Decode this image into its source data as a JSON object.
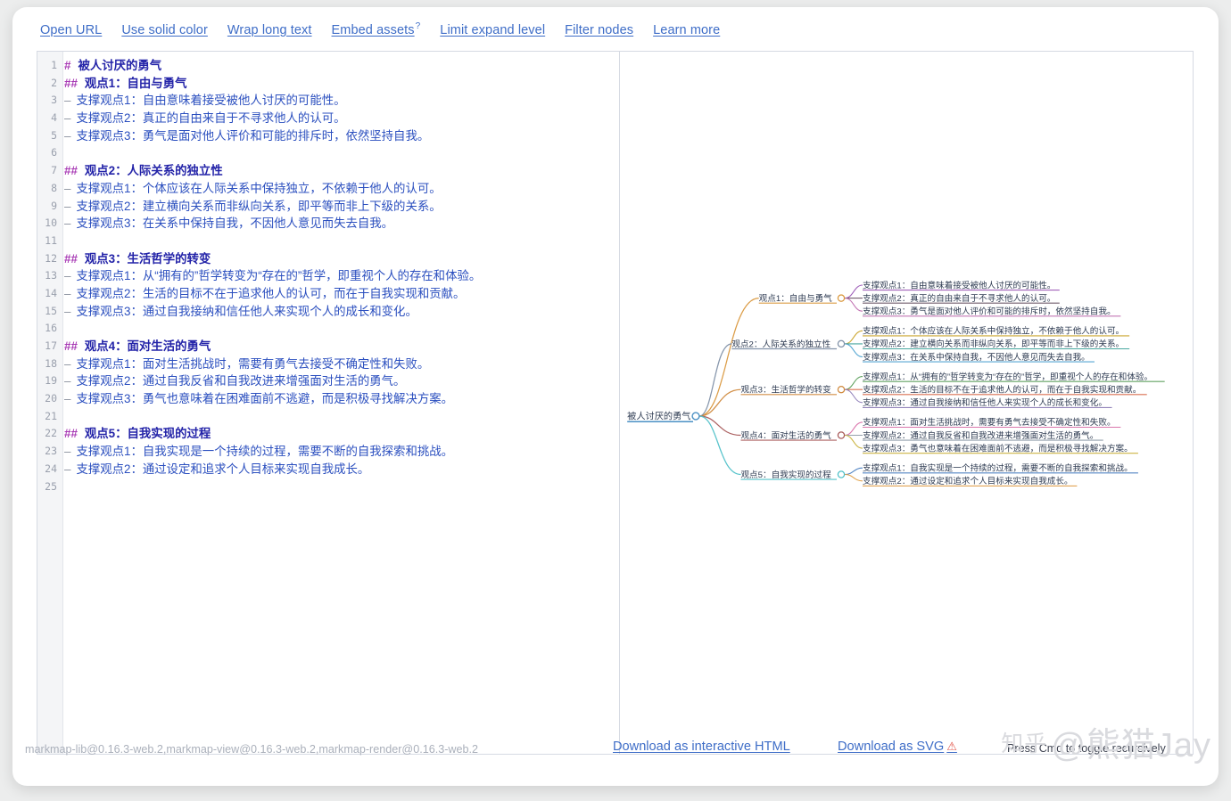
{
  "toolbar": {
    "links": [
      {
        "label": "Open URL",
        "sup": ""
      },
      {
        "label": "Use solid color",
        "sup": ""
      },
      {
        "label": "Wrap long text",
        "sup": ""
      },
      {
        "label": "Embed assets",
        "sup": "?"
      },
      {
        "label": "Limit expand level",
        "sup": ""
      },
      {
        "label": "Filter nodes",
        "sup": ""
      },
      {
        "label": "Learn more",
        "sup": ""
      }
    ]
  },
  "editor": {
    "line_numbers": [
      1,
      2,
      3,
      4,
      5,
      6,
      7,
      8,
      9,
      10,
      11,
      12,
      13,
      14,
      15,
      16,
      17,
      18,
      19,
      20,
      21,
      22,
      23,
      24,
      25
    ],
    "lines": [
      {
        "n": 1,
        "kind": "h1",
        "marker": "#",
        "text": "被人讨厌的勇气"
      },
      {
        "n": 2,
        "kind": "h2",
        "marker": "##",
        "text": "观点1：自由与勇气"
      },
      {
        "n": 3,
        "kind": "li",
        "marker": "–",
        "text": "支撑观点1：自由意味着接受被他人讨厌的可能性。"
      },
      {
        "n": 4,
        "kind": "li",
        "marker": "–",
        "text": "支撑观点2：真正的自由来自于不寻求他人的认可。"
      },
      {
        "n": 5,
        "kind": "li",
        "marker": "–",
        "text": "支撑观点3：勇气是面对他人评价和可能的排斥时，依然坚持自我。"
      },
      {
        "n": 6,
        "kind": "blank",
        "marker": "",
        "text": ""
      },
      {
        "n": 7,
        "kind": "h2",
        "marker": "##",
        "text": "观点2：人际关系的独立性"
      },
      {
        "n": 8,
        "kind": "li",
        "marker": "–",
        "text": "支撑观点1：个体应该在人际关系中保持独立，不依赖于他人的认可。"
      },
      {
        "n": 9,
        "kind": "li",
        "marker": "–",
        "text": "支撑观点2：建立横向关系而非纵向关系，即平等而非上下级的关系。"
      },
      {
        "n": 10,
        "kind": "li",
        "marker": "–",
        "text": "支撑观点3：在关系中保持自我，不因他人意见而失去自我。"
      },
      {
        "n": 11,
        "kind": "blank",
        "marker": "",
        "text": ""
      },
      {
        "n": 12,
        "kind": "h2",
        "marker": "##",
        "text": "观点3：生活哲学的转变"
      },
      {
        "n": 13,
        "kind": "li",
        "marker": "–",
        "text": "支撑观点1：从“拥有的”哲学转变为“存在的”哲学，即重视个人的存在和体验。"
      },
      {
        "n": 14,
        "kind": "li",
        "marker": "–",
        "text": "支撑观点2：生活的目标不在于追求他人的认可，而在于自我实现和贡献。"
      },
      {
        "n": 15,
        "kind": "li",
        "marker": "–",
        "text": "支撑观点3：通过自我接纳和信任他人来实现个人的成长和变化。"
      },
      {
        "n": 16,
        "kind": "blank",
        "marker": "",
        "text": ""
      },
      {
        "n": 17,
        "kind": "h2",
        "marker": "##",
        "text": "观点4：面对生活的勇气"
      },
      {
        "n": 18,
        "kind": "li",
        "marker": "–",
        "text": "支撑观点1：面对生活挑战时，需要有勇气去接受不确定性和失败。"
      },
      {
        "n": 19,
        "kind": "li",
        "marker": "–",
        "text": "支撑观点2：通过自我反省和自我改进来增强面对生活的勇气。"
      },
      {
        "n": 20,
        "kind": "li",
        "marker": "–",
        "text": "支撑观点3：勇气也意味着在困难面前不逃避，而是积极寻找解决方案。"
      },
      {
        "n": 21,
        "kind": "blank",
        "marker": "",
        "text": ""
      },
      {
        "n": 22,
        "kind": "h2",
        "marker": "##",
        "text": "观点5：自我实现的过程"
      },
      {
        "n": 23,
        "kind": "li",
        "marker": "–",
        "text": "支撑观点1：自我实现是一个持续的过程，需要不断的自我探索和挑战。"
      },
      {
        "n": 24,
        "kind": "li",
        "marker": "–",
        "text": "支撑观点2：通过设定和追求个人目标来实现自我成长。"
      },
      {
        "n": 25,
        "kind": "blank",
        "marker": "",
        "text": ""
      }
    ]
  },
  "mindmap": {
    "root": {
      "label": "被人讨厌的勇气",
      "color": "#4a90c4"
    },
    "branches": [
      {
        "label": "观点1：自由与勇气",
        "color": "#d9973c",
        "children": [
          {
            "label": "支撑观点1：自由意味着接受被他人讨厌的可能性。",
            "color": "#9b59b6"
          },
          {
            "label": "支撑观点2：真正的自由来自于不寻求他人的认可。",
            "color": "#6b5566"
          },
          {
            "label": "支撑观点3：勇气是面对他人评价和可能的排斥时，依然坚持自我。",
            "color": "#c06fb0"
          }
        ]
      },
      {
        "label": "观点2：人际关系的独立性",
        "color": "#7e8fa6",
        "children": [
          {
            "label": "支撑观点1：个体应该在人际关系中保持独立，不依赖于他人的认可。",
            "color": "#c9a227"
          },
          {
            "label": "支撑观点2：建立横向关系而非纵向关系，即平等而非上下级的关系。",
            "color": "#3fa39a"
          },
          {
            "label": "支撑观点3：在关系中保持自我，不因他人意见而失去自我。",
            "color": "#4fa3d1"
          }
        ]
      },
      {
        "label": "观点3：生活哲学的转变",
        "color": "#d08a3e",
        "children": [
          {
            "label": "支撑观点1：从“拥有的”哲学转变为“存在的”哲学，即重视个人的存在和体验。",
            "color": "#5a9e5a"
          },
          {
            "label": "支撑观点2：生活的目标不在于追求他人的认可，而在于自我实现和贡献。",
            "color": "#d96a4a"
          },
          {
            "label": "支撑观点3：通过自我接纳和信任他人来实现个人的成长和变化。",
            "color": "#8f7fb8"
          }
        ]
      },
      {
        "label": "观点4：面对生活的勇气",
        "color": "#a85a5a",
        "children": [
          {
            "label": "支撑观点1：面对生活挑战时，需要有勇气去接受不确定性和失败。",
            "color": "#d96fa8"
          },
          {
            "label": "支撑观点2：通过自我反省和自我改进来增强面对生活的勇气。",
            "color": "#8f9ba8"
          },
          {
            "label": "支撑观点3：勇气也意味着在困难面前不逃避，而是积极寻找解决方案。",
            "color": "#c9b23c"
          }
        ]
      },
      {
        "label": "观点5：自我实现的过程",
        "color": "#4ec0c8",
        "children": [
          {
            "label": "支撑观点1：自我实现是一个持续的过程，需要不断的自我探索和挑战。",
            "color": "#4a7fc1"
          },
          {
            "label": "支撑观点2：通过设定和追求个人目标来实现自我成长。",
            "color": "#e0a04a"
          }
        ]
      }
    ]
  },
  "footer": {
    "version": "markmap-lib@0.16.3-web.2,markmap-view@0.16.3-web.2,markmap-render@0.16.3-web.2",
    "download_html": "Download as interactive HTML",
    "download_svg": "Download as SVG",
    "warn_icon": "⚠",
    "hint": "Press Cmd to toggle recursively"
  },
  "watermark": {
    "zh": "知乎",
    "handle": "@熊猫Jay"
  }
}
